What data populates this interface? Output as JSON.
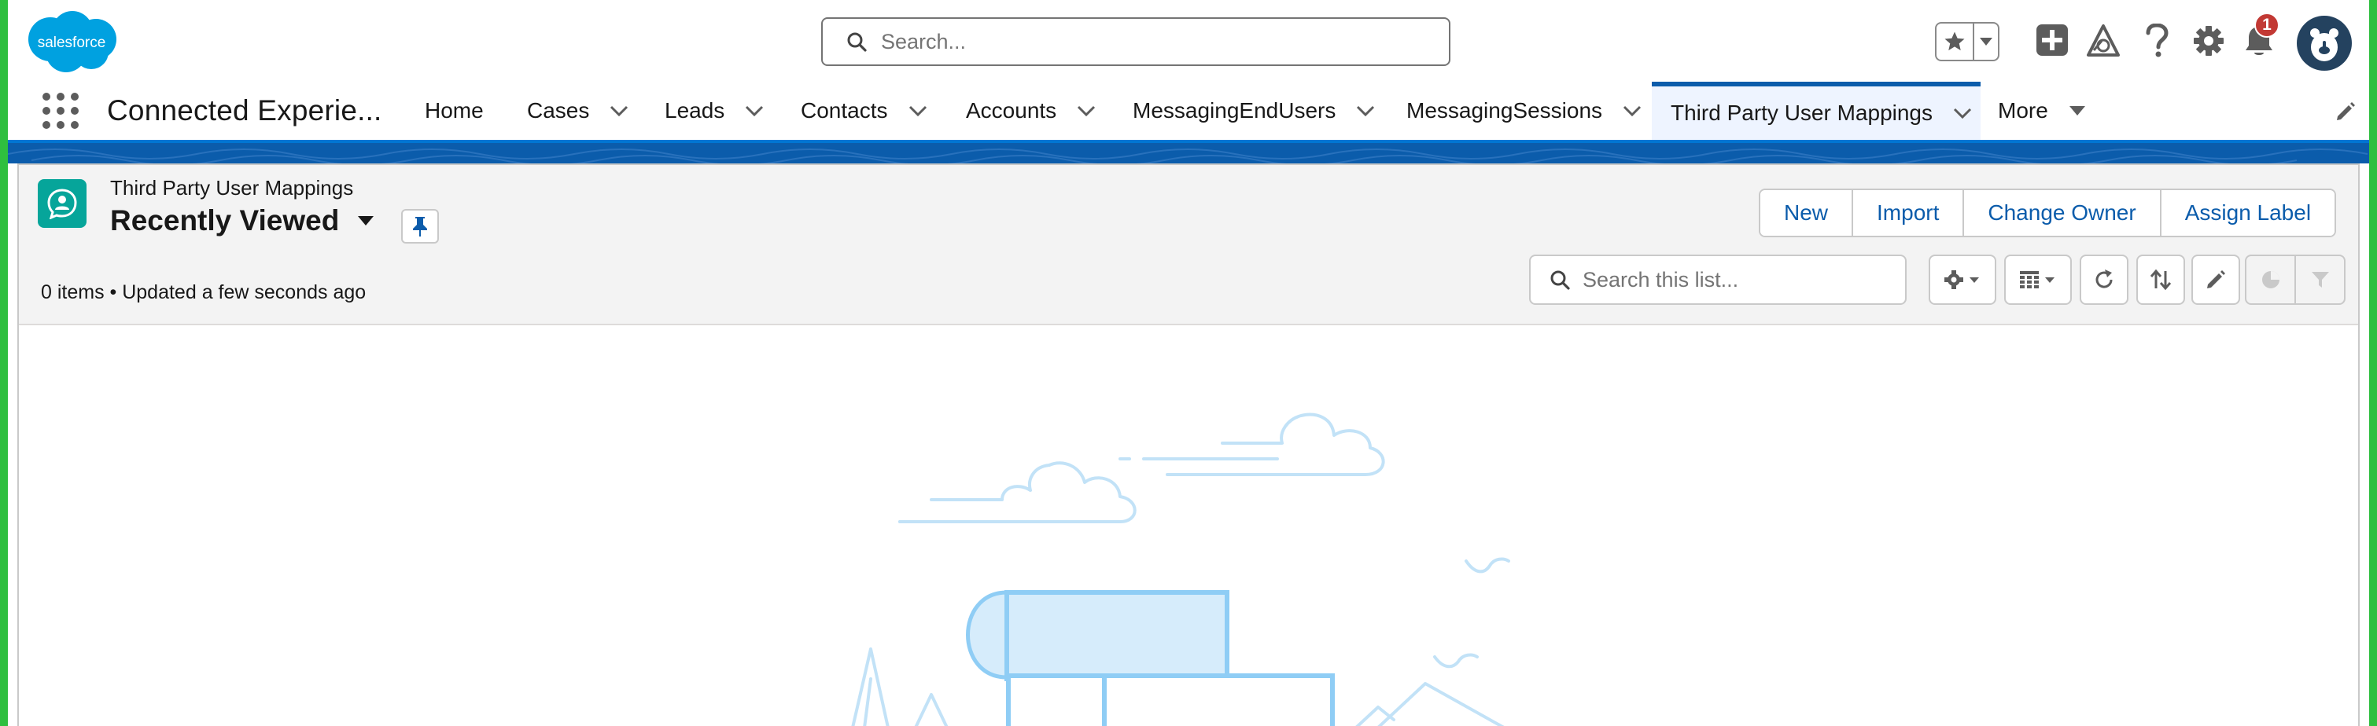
{
  "header": {
    "logo_text": "salesforce",
    "search_placeholder": "Search...",
    "notification_count": "1",
    "icons": [
      "favorites-star-icon",
      "chevron-down-icon",
      "global-add-icon",
      "trailhead-icon",
      "help-icon",
      "setup-gear-icon",
      "notification-bell-icon",
      "avatar-icon"
    ]
  },
  "nav": {
    "app_name": "Connected Experie...",
    "tabs": [
      {
        "label": "Home"
      },
      {
        "label": "Cases"
      },
      {
        "label": "Leads"
      },
      {
        "label": "Contacts"
      },
      {
        "label": "Accounts"
      },
      {
        "label": "MessagingEndUsers"
      },
      {
        "label": "MessagingSessions"
      },
      {
        "label": "Third Party User Mappings",
        "active": true
      },
      {
        "label": "More"
      }
    ]
  },
  "list": {
    "object_label": "Third Party User Mappings",
    "view_name": "Recently Viewed",
    "meta": "0 items • Updated a few seconds ago",
    "actions": [
      "New",
      "Import",
      "Change Owner",
      "Assign Label"
    ],
    "search_placeholder": "Search this list...",
    "toolbar_icons": [
      "list-settings-icon",
      "display-as-table-icon",
      "refresh-icon",
      "sort-icon",
      "edit-inline-icon",
      "chart-icon",
      "filter-icon"
    ]
  },
  "colors": {
    "brand_blue": "#0b5cab",
    "accent_blue": "#0176d3",
    "object_icon_teal": "#06a59a",
    "notification_red": "#c23934",
    "illustration_line": "#c2e2f7",
    "illustration_strong": "#8fcdf5"
  }
}
